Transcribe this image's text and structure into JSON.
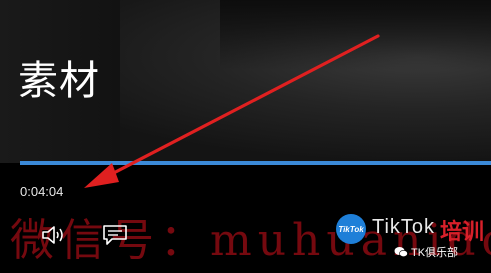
{
  "video": {
    "title": "素材",
    "current_time": "0:04:04",
    "progress_fraction": 1.0
  },
  "overlay": {
    "watermark_text": "微信号：muhuanidc"
  },
  "controls": {
    "volume_icon": "speaker-icon",
    "captions_icon": "captions-icon"
  },
  "branding": {
    "circle_text": "TikTok",
    "brand_text": "TikTok",
    "training_text": "培训",
    "club_text": "TK俱乐部"
  },
  "colors": {
    "progress_accent": "#3b8ad8",
    "annotation_arrow": "#e02020",
    "watermark": "#8a0b12"
  }
}
